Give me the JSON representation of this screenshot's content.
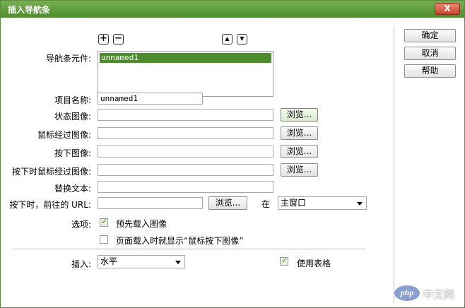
{
  "dialog": {
    "title": "插入导航条",
    "close_label": "X"
  },
  "side_buttons": {
    "ok": "确定",
    "cancel": "取消",
    "help": "帮助"
  },
  "nav_elements": {
    "label": "导航条元件:",
    "add": "+",
    "remove": "−",
    "move_up": "▲",
    "move_down": "▼",
    "items": [
      "unnamed1"
    ]
  },
  "item_name": {
    "label": "项目名称:",
    "value": "unnamed1"
  },
  "up_image": {
    "label": "状态图像:",
    "value": "",
    "browse": "浏览..."
  },
  "over_image": {
    "label": "鼠标经过图像:",
    "value": "",
    "browse": "浏览..."
  },
  "down_image": {
    "label": "按下图像:",
    "value": "",
    "browse": "浏览..."
  },
  "over_while_down_image": {
    "label": "按下时鼠标经过图像:",
    "value": "",
    "browse": "浏览..."
  },
  "alt_text": {
    "label": "替换文本:",
    "value": ""
  },
  "url": {
    "label": "按下时，前往的 URL:",
    "value": "",
    "browse": "浏览...",
    "in_label": "在",
    "target": "主窗口"
  },
  "options": {
    "label": "选项:",
    "preload": {
      "label": "预先载入图像",
      "checked": true
    },
    "show_down_initially": {
      "label": "页面载入时就显示“鼠标按下图像”",
      "checked": false
    }
  },
  "insert": {
    "label": "插入:",
    "value": "水平"
  },
  "use_tables": {
    "label": "使用表格",
    "checked": true
  },
  "watermark": {
    "php": "php",
    "site": "中文网"
  }
}
